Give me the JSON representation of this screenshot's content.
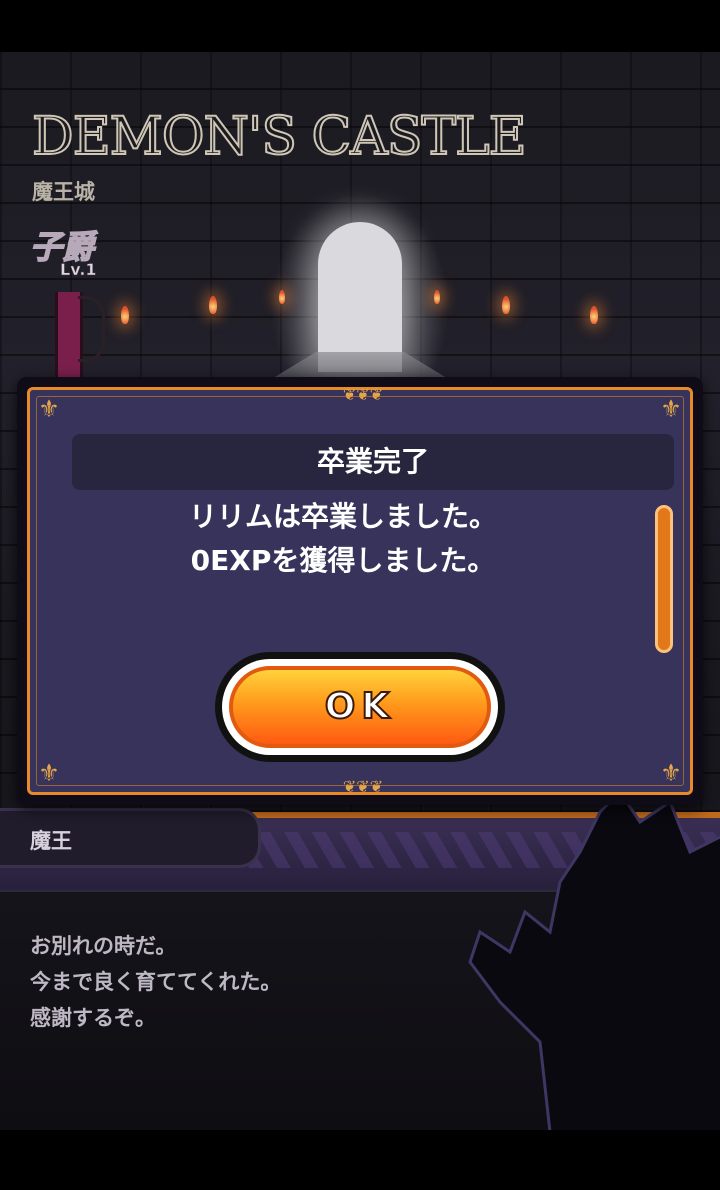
{
  "scene": {
    "logo": "DEMON'S CASTLE",
    "location": "魔王城",
    "rank": "子爵",
    "rank_level": "Lv.1"
  },
  "dialogue": {
    "speaker": "魔王",
    "lines": [
      "お別れの時だ。",
      "今まで良く育ててくれた。",
      "感謝するぞ。"
    ]
  },
  "modal": {
    "title": "卒業完了",
    "message": [
      "リリムは卒業しました。",
      "0EXPを獲得しました。"
    ],
    "ok_label": "OK"
  },
  "colors": {
    "modal_fill": "#37335b",
    "modal_border": "#e88a2a",
    "ok_button_gradient": [
      "#ffd23a",
      "#ff5a12"
    ],
    "scrollbar": "#e2781a"
  },
  "icons": {
    "corner": "fleur-de-lis-icon",
    "ornament": "scroll-ornament-icon"
  }
}
